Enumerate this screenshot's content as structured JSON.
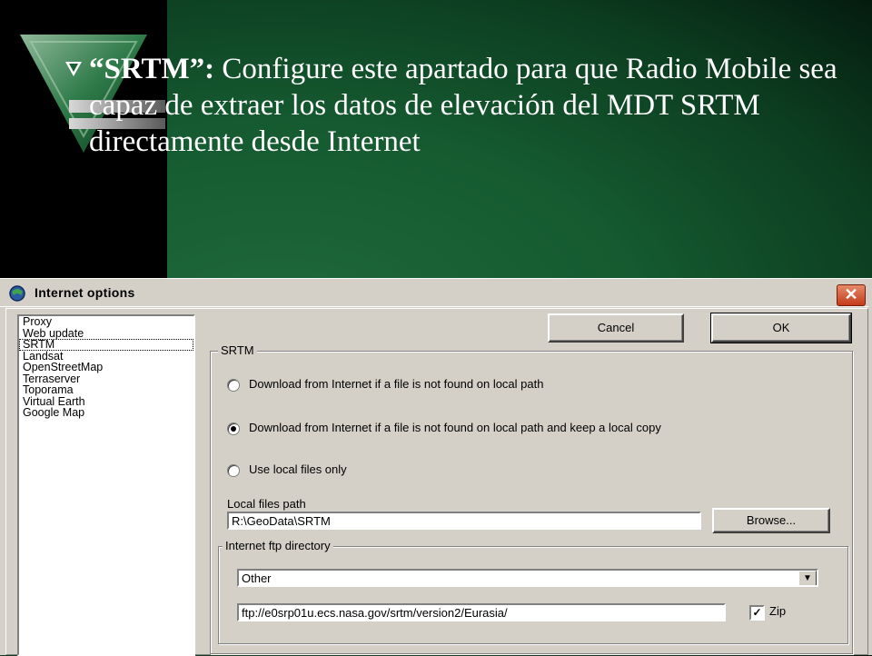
{
  "slide": {
    "bullet_glyph": "Ÿ",
    "bullet_bold": "“SRTM”:",
    "bullet_rest": " Configure este apartado para que Radio Mobile sea capaz de extraer los datos de elevación del MDT SRTM directamente desde Internet"
  },
  "dialog": {
    "title": "Internet options",
    "close_glyph": "✕",
    "list_items": [
      "Proxy",
      "Web update",
      "SRTM",
      "Landsat",
      "OpenStreetMap",
      "Terraserver",
      "Toporama",
      "Virtual Earth",
      "Google Map"
    ],
    "selected_index": 2,
    "cancel_label": "Cancel",
    "ok_label": "OK",
    "group_title": "SRTM",
    "radio_1": "Download from Internet if a file is not found on local path",
    "radio_2": "Download from Internet if a file is not found on local path and keep a local copy",
    "radio_3": "Use local files only",
    "selected_radio": 2,
    "local_path_label": "Local files path",
    "local_path_value": "R:\\GeoData\\SRTM",
    "browse_label": "Browse...",
    "ftp_group_title": "Internet ftp directory",
    "ftp_select_value": "Other",
    "ftp_url_value": "ftp://e0srp01u.ecs.nasa.gov/srtm/version2/Eurasia/",
    "zip_label": "Zip",
    "zip_checked": true
  },
  "colors": {
    "slide_green": "#1f6a3c",
    "dialog_face": "#d4d0c8",
    "close_red": "#c43a1a"
  }
}
